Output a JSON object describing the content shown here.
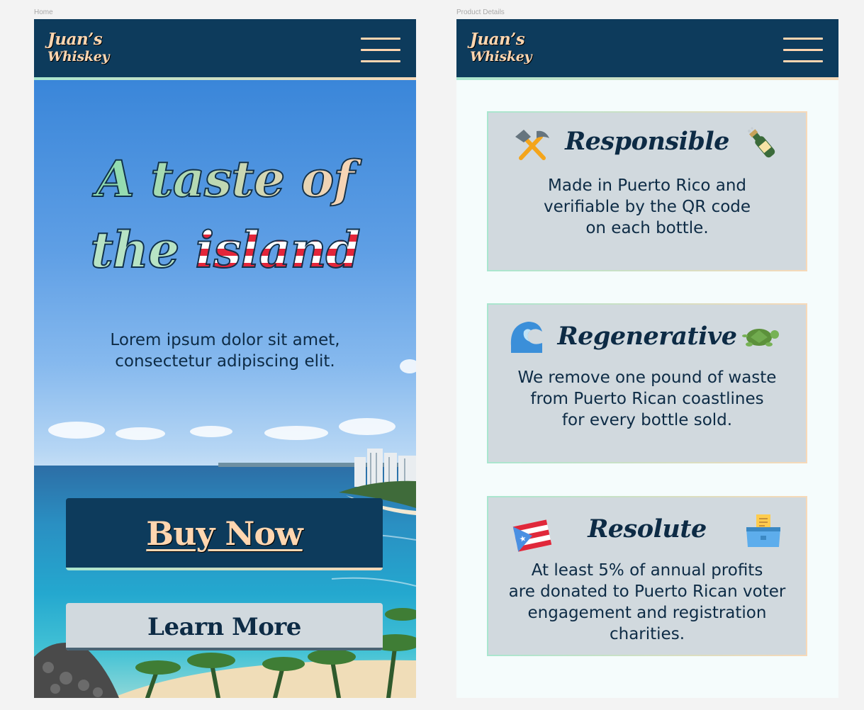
{
  "frames": {
    "home_label": "Home",
    "details_label": "Product Details"
  },
  "logo": {
    "line1": "Juan’s",
    "line2": "Whiskey"
  },
  "home": {
    "title_line1": "A taste of",
    "title_word_the": "the",
    "title_word_island": "island",
    "subtitle_line1": "Lorem ipsum dolor sit amet,",
    "subtitle_line2": "consectetur adipiscing elit.",
    "buy_label": "Buy Now",
    "learn_label": "Learn More"
  },
  "details": {
    "cards": [
      {
        "title": "Responsible",
        "lines": [
          "Made in Puerto Rico and",
          "verifiable by the QR code",
          "on each bottle."
        ],
        "left_icon": "hammer-pick-icon",
        "right_icon": "champagne-bottle-icon"
      },
      {
        "title": "Regenerative",
        "lines": [
          "We remove one pound of waste",
          "from Puerto Rican coastlines",
          "for every bottle sold."
        ],
        "left_icon": "wave-icon",
        "right_icon": "turtle-icon"
      },
      {
        "title": "Resolute",
        "lines": [
          "At least 5% of annual profits",
          "are donated to Puerto Rican voter",
          "engagement and registration",
          "charities."
        ],
        "left_icon": "puerto-rico-flag-icon",
        "right_icon": "ballot-box-icon"
      }
    ]
  },
  "colors": {
    "navy": "#0d3b5c",
    "peach": "#ffd6b0",
    "mint": "#a9e6cf",
    "card_gray": "#d1d9de"
  }
}
